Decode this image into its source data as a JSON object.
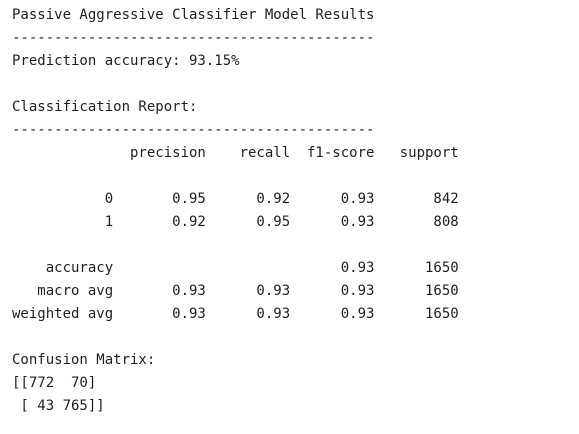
{
  "output": {
    "lines": [
      "Passive Aggressive Classifier Model Results",
      "-------------------------------------------",
      "Prediction accuracy: 93.15%",
      "",
      "Classification Report:",
      "-------------------------------------------",
      "              precision    recall  f1-score   support",
      "",
      "           0       0.95      0.92      0.93       842",
      "           1       0.92      0.95      0.93       808",
      "",
      "    accuracy                           0.93      1650",
      "   macro avg       0.93      0.93      0.93      1650",
      "weighted avg       0.93      0.93      0.93      1650",
      "",
      "Confusion Matrix:",
      "[[772  70]",
      " [ 43 765]]"
    ]
  }
}
